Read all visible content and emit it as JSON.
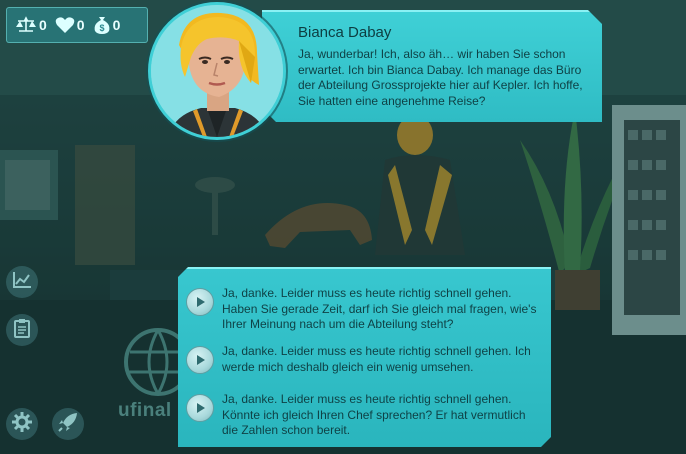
{
  "stats": {
    "justice": "0",
    "health": "0",
    "money": "0"
  },
  "dialogue": {
    "speaker": "Bianca Dabay",
    "text": "Ja, wunderbar! Ich, also äh… wir haben Sie schon erwartet. Ich bin Bianca Dabay. Ich manage das Büro der Abteilung Grossprojekte hier auf Kepler. Ich hoffe, Sie hatten eine angenehme Reise?"
  },
  "answers": [
    {
      "text": "Ja, danke. Leider muss es heute richtig schnell gehen. Haben Sie gerade Zeit, darf ich Sie gleich mal fragen, wie's Ihrer Meinung nach um die Abteilung steht?"
    },
    {
      "text": "Ja, danke. Leider muss es heute richtig schnell gehen. Ich werde mich deshalb gleich ein wenig umsehen."
    },
    {
      "text": "Ja, danke. Leider muss es heute richtig schnell gehen. Könnte ich gleich Ihren Chef sprechen? Er hat vermutlich die Zahlen schon bereit."
    }
  ],
  "logo_text": "ufinal",
  "icons": {
    "justice": "scales-icon",
    "health": "heart-icon",
    "money": "money-bag-icon",
    "chart": "chart-icon",
    "notes": "clipboard-icon",
    "settings": "gear-icon",
    "rocket": "rocket-icon",
    "play": "play-icon"
  },
  "colors": {
    "panel": "#38c7cf",
    "panel_border": "#8af1f4",
    "text": "#0f4246",
    "background": "#1c3c3c"
  }
}
